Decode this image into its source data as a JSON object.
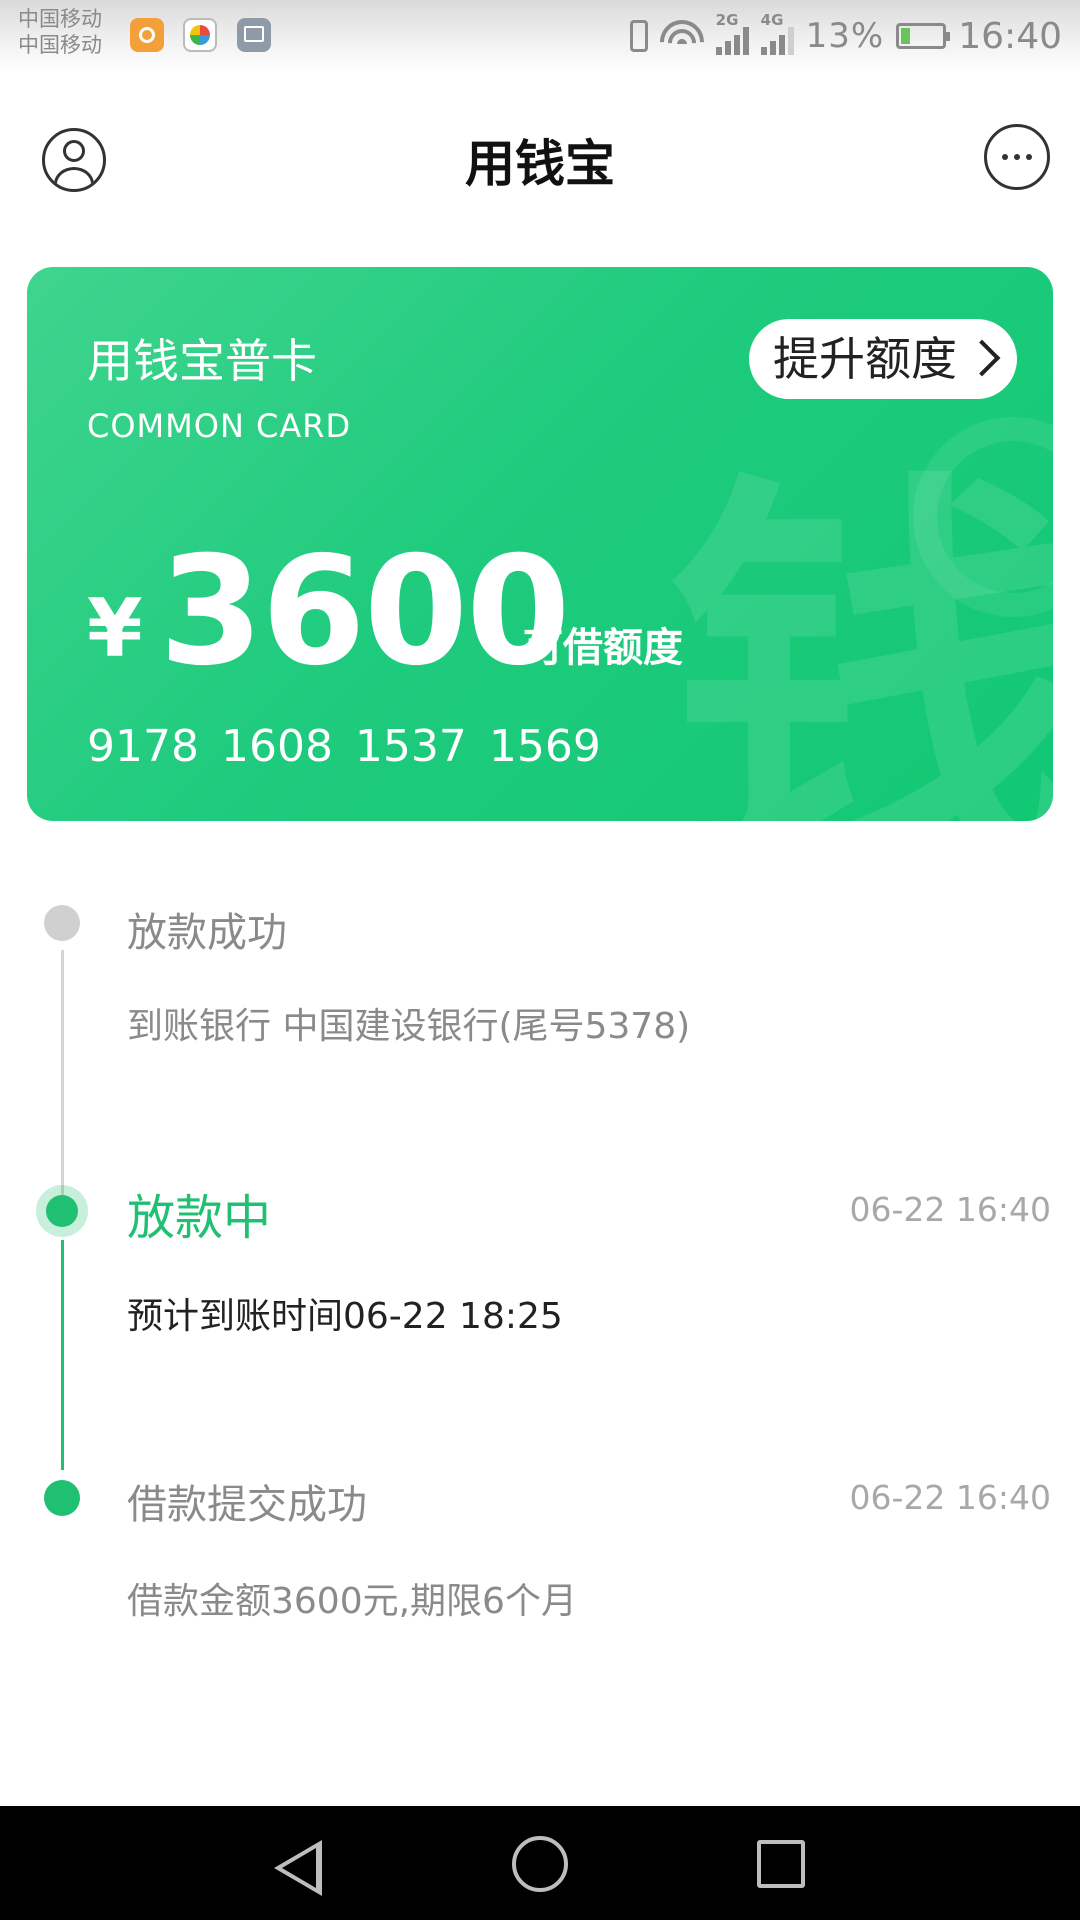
{
  "status_bar": {
    "carrier_1": "中国移动",
    "carrier_2": "中国移动",
    "net_2g": "2G",
    "net_4g": "4G",
    "battery_percent": "13%",
    "time": "16:40"
  },
  "header": {
    "title": "用钱宝"
  },
  "card": {
    "title": "用钱宝普卡",
    "subtitle": "COMMON CARD",
    "raise_button": "提升额度",
    "currency": "¥",
    "amount": "3600",
    "amount_label": "可借额度",
    "card_number": "9178 1608 1537 1569",
    "watermark": "钱"
  },
  "timeline": {
    "steps": [
      {
        "title": "放款成功",
        "desc": "到账银行 中国建设银行(尾号5378)",
        "time": ""
      },
      {
        "title": "放款中",
        "desc": "预计到账时间06-22 18:25",
        "time": "06-22 16:40"
      },
      {
        "title": "借款提交成功",
        "desc": "借款金额3600元,期限6个月",
        "time": "06-22 16:40"
      }
    ]
  },
  "colors": {
    "accent_green": "#20c073",
    "card_gradient_start": "#3fd48e",
    "card_gradient_end": "#12c873",
    "muted_text": "#8a8a8a"
  }
}
